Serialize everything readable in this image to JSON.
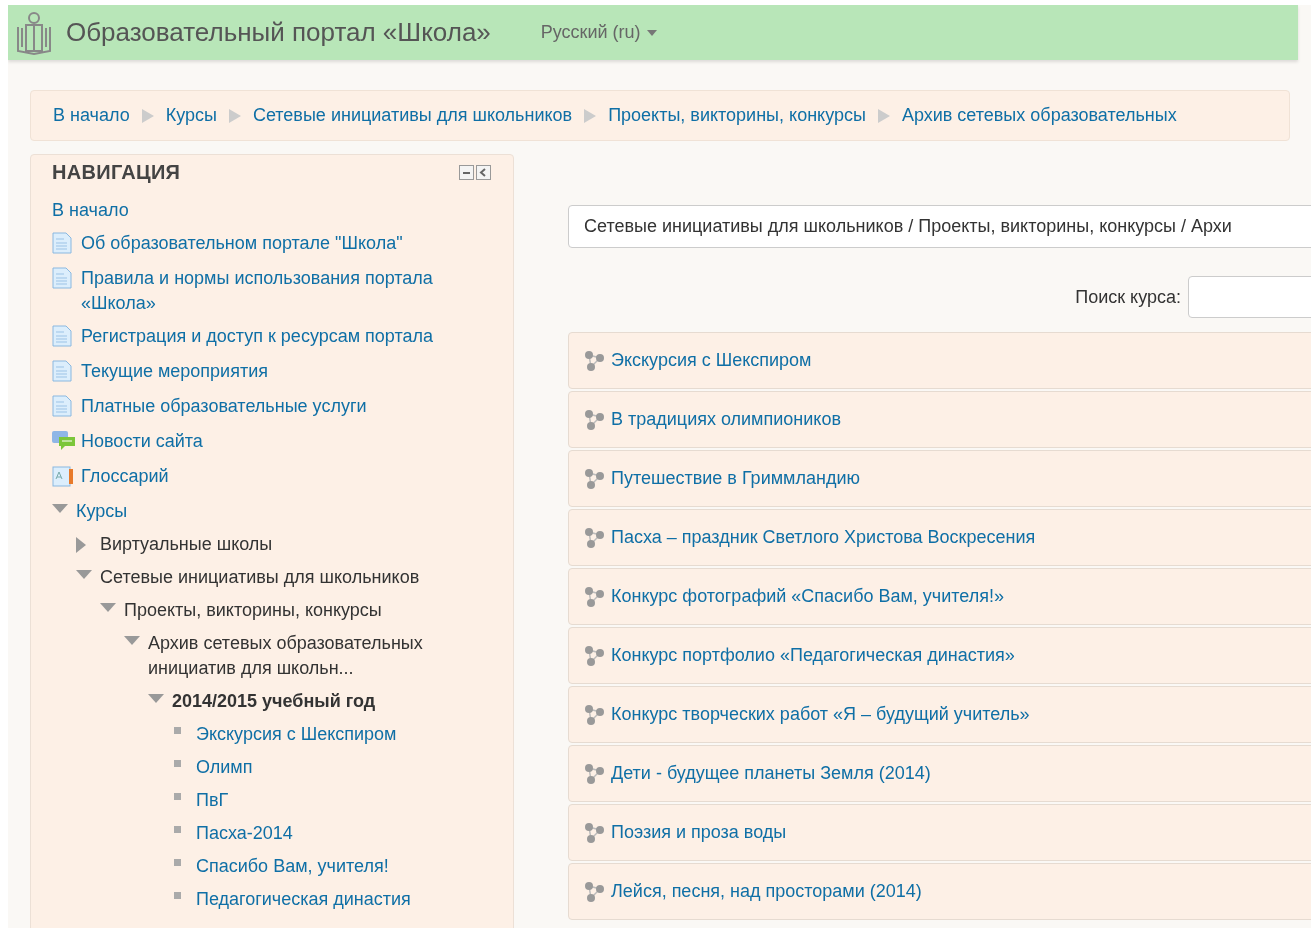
{
  "header": {
    "title": "Образовательный портал «Школа»",
    "language": "Русский (ru)"
  },
  "breadcrumb": [
    "В начало",
    "Курсы",
    "Сетевые инициативы для школьников",
    "Проекты, викторины, конкурсы",
    "Архив сетевых образовательных"
  ],
  "navigation": {
    "title": "НАВИГАЦИЯ",
    "items": [
      {
        "kind": "home",
        "label": "В начало"
      },
      {
        "kind": "page",
        "label": "Об образовательном портале \"Школа\""
      },
      {
        "kind": "page",
        "label": "Правила и нормы использования портала «Школа»"
      },
      {
        "kind": "page",
        "label": "Регистрация и доступ к ресурсам портала"
      },
      {
        "kind": "page",
        "label": "Текущие мероприятия"
      },
      {
        "kind": "page",
        "label": "Платные образовательные услуги"
      },
      {
        "kind": "forum",
        "label": "Новости сайта"
      },
      {
        "kind": "glossary",
        "label": "Глоссарий"
      },
      {
        "kind": "branch",
        "label": "Курсы",
        "expanded": true,
        "children": [
          {
            "kind": "category",
            "label": "Виртуальные школы",
            "expanded": false
          },
          {
            "kind": "category",
            "label": "Сетевые инициативы для школьников",
            "expanded": true,
            "children": [
              {
                "kind": "category",
                "label": "Проекты, викторины, конкурсы",
                "expanded": true,
                "children": [
                  {
                    "kind": "category",
                    "label": "Архив сетевых образовательных инициатив для школьн...",
                    "expanded": true,
                    "children": [
                      {
                        "kind": "category",
                        "label": "2014/2015 учебный год",
                        "expanded": true,
                        "current": true,
                        "children": [
                          {
                            "kind": "course",
                            "label": "Экскурсия с Шекспиром"
                          },
                          {
                            "kind": "course",
                            "label": "Олимп"
                          },
                          {
                            "kind": "course",
                            "label": "ПвГ"
                          },
                          {
                            "kind": "course",
                            "label": "Пасха-2014"
                          },
                          {
                            "kind": "course",
                            "label": "Спасибо Вам, учителя!"
                          },
                          {
                            "kind": "course",
                            "label": "Педагогическая династия"
                          }
                        ]
                      }
                    ]
                  }
                ]
              }
            ]
          }
        ]
      }
    ]
  },
  "category_select": {
    "value": "Сетевые инициативы для школьников / Проекты, викторины, конкурсы / Архи"
  },
  "course_search": {
    "label": "Поиск курса:"
  },
  "courses": [
    "Экскурсия с Шекспиром",
    "В традициях олимпиоников",
    "Путешествие в Гриммландию",
    "Пасха – праздник Светлого Христова Воскресения",
    "Конкурс фотографий «Спасибо Вам, учителя!»",
    "Конкурс портфолио «Педагогическая династия»",
    "Конкурс творческих работ «Я – будущий учитель»",
    "Дети - будущее планеты Земля (2014)",
    "Поэзия и проза воды",
    "Лейся, песня, над просторами (2014)"
  ]
}
